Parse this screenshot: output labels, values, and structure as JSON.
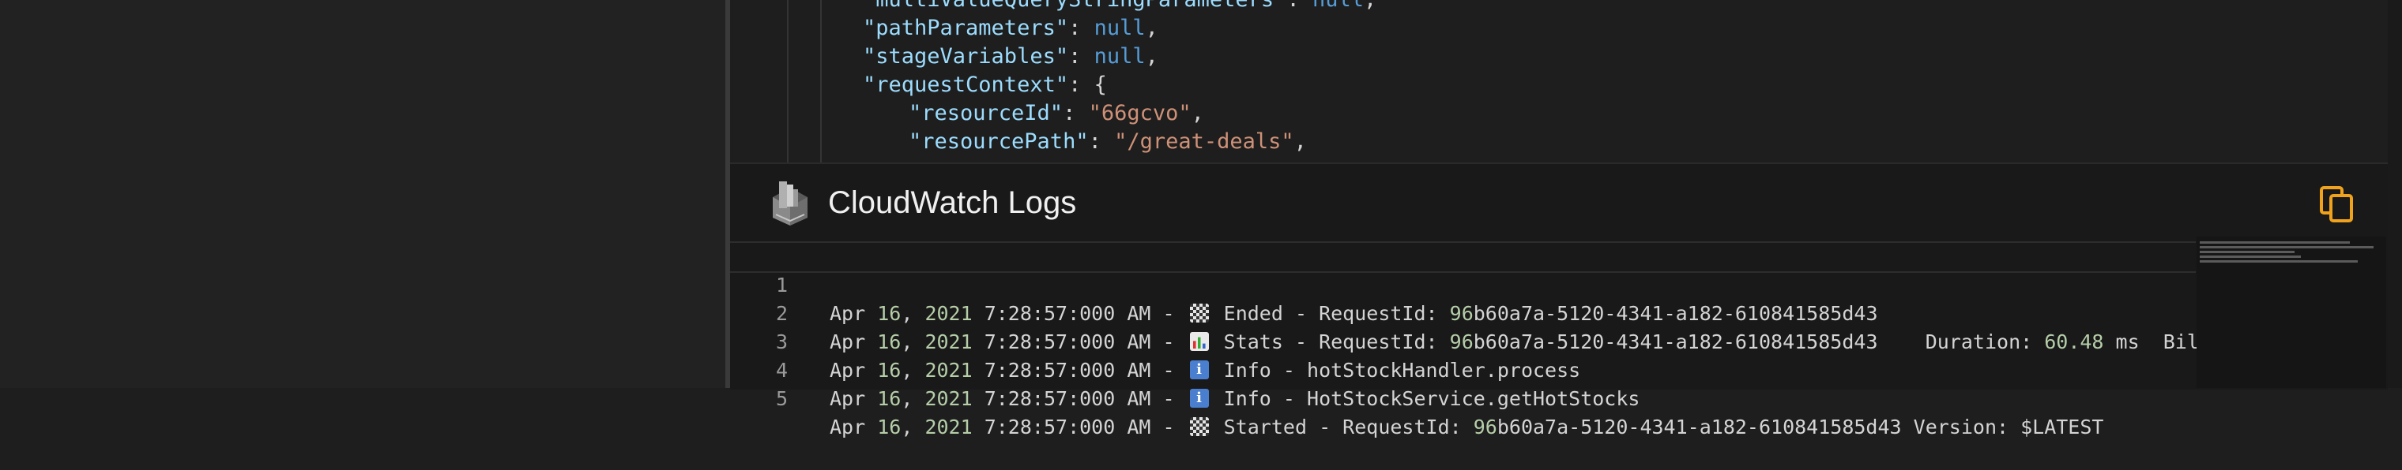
{
  "editor": {
    "lines": [
      {
        "key": "\"multiValueQueryStringParameters\"",
        "sep": ": ",
        "value": "null",
        "value_type": "kw",
        "trail": ","
      },
      {
        "key": "\"pathParameters\"",
        "sep": ": ",
        "value": "null",
        "value_type": "kw",
        "trail": ","
      },
      {
        "key": "\"stageVariables\"",
        "sep": ": ",
        "value": "null",
        "value_type": "kw",
        "trail": ","
      },
      {
        "key": "\"requestContext\"",
        "sep": ": ",
        "value": "{",
        "value_type": "punc",
        "trail": ""
      },
      {
        "key": "\"resourceId\"",
        "sep": ": ",
        "value": "\"66gcvo\"",
        "value_type": "str",
        "trail": ","
      },
      {
        "key": "\"resourcePath\"",
        "sep": ": ",
        "value": "\"/great-deals\"",
        "value_type": "str",
        "trail": ","
      }
    ]
  },
  "panel": {
    "title": "CloudWatch Logs",
    "icon": "cloudwatch-logs-icon",
    "copy_icon": "copy-icon",
    "accent": "#f0a21c"
  },
  "logs": [
    {
      "ln": "1",
      "date": "Apr ",
      "d1": "16",
      "c1": ", ",
      "year": "2021",
      "time": " 7:28:57:000 AM - ",
      "emoji": "flag",
      "pre": "Ended - RequestId: ",
      "reqnum": "96",
      "rest": "b60a7a-5120-4341-a182-610841585d43",
      "extra1": "",
      "extra_num": "",
      "extra2": ""
    },
    {
      "ln": "2",
      "date": "Apr ",
      "d1": "16",
      "c1": ", ",
      "year": "2021",
      "time": " 7:28:57:000 AM - ",
      "emoji": "chart",
      "pre": "Stats - RequestId: ",
      "reqnum": "96",
      "rest": "b60a7a-5120-4341-a182-610841585d43",
      "extra1": "    Duration: ",
      "extra_num": "60.48",
      "extra2": " ms  Billed D"
    },
    {
      "ln": "3",
      "date": "Apr ",
      "d1": "16",
      "c1": ", ",
      "year": "2021",
      "time": " 7:28:57:000 AM - ",
      "emoji": "info",
      "pre": "Info - hotStockHandler.process",
      "reqnum": "",
      "rest": "",
      "extra1": "",
      "extra_num": "",
      "extra2": ""
    },
    {
      "ln": "4",
      "date": "Apr ",
      "d1": "16",
      "c1": ", ",
      "year": "2021",
      "time": " 7:28:57:000 AM - ",
      "emoji": "info",
      "pre": "Info - HotStockService.getHotStocks",
      "reqnum": "",
      "rest": "",
      "extra1": "",
      "extra_num": "",
      "extra2": ""
    },
    {
      "ln": "5",
      "date": "Apr ",
      "d1": "16",
      "c1": ", ",
      "year": "2021",
      "time": " 7:28:57:000 AM - ",
      "emoji": "flag",
      "pre": "Started - RequestId: ",
      "reqnum": "96",
      "rest": "b60a7a-5120-4341-a182-610841585d43 Version: $LATEST",
      "extra1": "",
      "extra_num": "",
      "extra2": ""
    }
  ]
}
